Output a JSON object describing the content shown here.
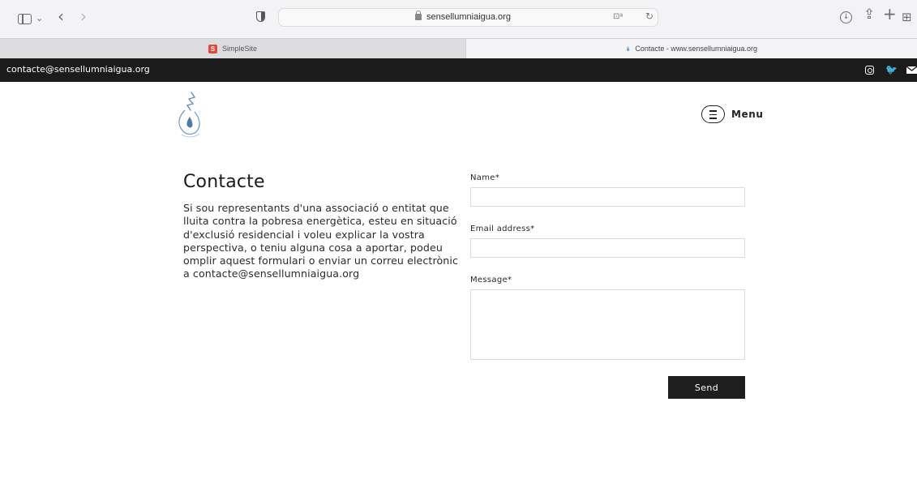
{
  "browser": {
    "address": "sensellumniaigua.org",
    "tabs": [
      {
        "label": "SimpleSite",
        "favicon": "S"
      },
      {
        "label": "Contacte - www.sensellumniaigua.org"
      }
    ]
  },
  "topbar": {
    "email": "contacte@sensellumniaigua.org",
    "social_icons": [
      "instagram-icon",
      "twitter-icon",
      "mail-icon"
    ]
  },
  "header": {
    "menu_label": "Menu"
  },
  "content": {
    "title": "Contacte",
    "intro": "Si sou representants d'una associació o entitat que lluita contra la pobresa energètica, esteu en situació d'exclusió residencial i voleu explicar la vostra perspectiva, o teniu alguna cosa a aportar, podeu omplir aquest formulari o enviar un correu electrònic a contacte@sensellumniaigua.org"
  },
  "form": {
    "name_label": "Name*",
    "email_label": "Email address*",
    "message_label": "Message*",
    "send_label": "Send"
  },
  "colors": {
    "topbar_bg": "#1b1b1b",
    "button_bg": "#1e1e1e",
    "accent_logo": "#7a9ec4"
  }
}
